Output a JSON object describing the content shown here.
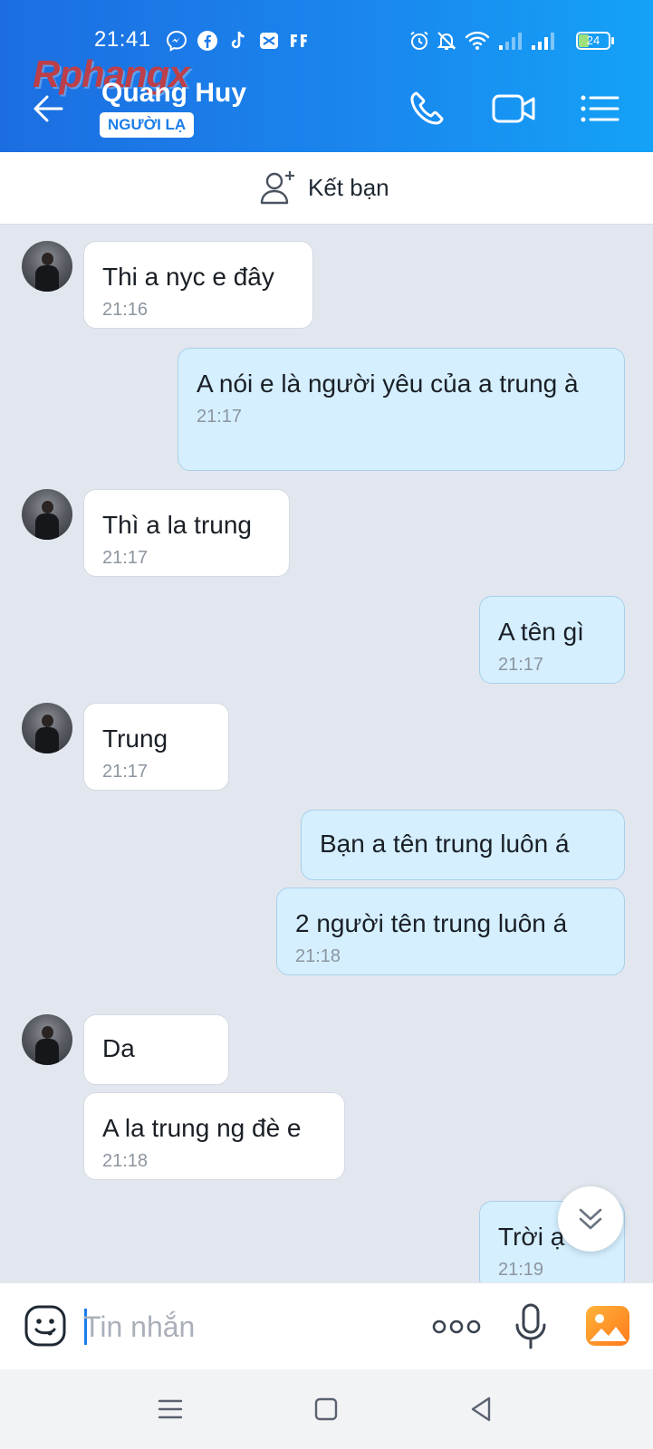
{
  "status_bar": {
    "time": "21:41",
    "battery": "24"
  },
  "watermark": "Rphangx",
  "header": {
    "title": "Quang Huy",
    "badge": "NGƯỜI LẠ"
  },
  "add_friend": {
    "label": "Kết bạn"
  },
  "messages": [
    {
      "side": "in",
      "text": "Thi a nyc e đây",
      "time": "21:16"
    },
    {
      "side": "out",
      "text": "A nói e là người yêu của a trung à",
      "time": "21:17"
    },
    {
      "side": "in",
      "text": "Thì a la trung",
      "time": "21:17"
    },
    {
      "side": "out",
      "text": "A tên gì",
      "time": "21:17"
    },
    {
      "side": "in",
      "text": "Trung",
      "time": "21:17"
    },
    {
      "side": "out",
      "text": "Bạn a tên trung luôn á",
      "time": ""
    },
    {
      "side": "out",
      "text": "2 người tên trung luôn á",
      "time": "21:18"
    },
    {
      "side": "in",
      "text": "Da",
      "time": ""
    },
    {
      "side": "in",
      "text": "A la trung ng đè e",
      "time": "21:18"
    },
    {
      "side": "out",
      "text": "Trời ạ",
      "time": "21:19"
    }
  ],
  "composer": {
    "placeholder": "Tin nhắn"
  },
  "colors": {
    "header_start": "#1c6ee0",
    "header_end": "#14a2f7",
    "outgoing_bubble": "#d5efff",
    "incoming_bubble": "#ffffff",
    "chat_background": "#e2e7ef",
    "accent": "#1b7de8"
  },
  "icons": {
    "back": "arrow-left-icon",
    "call": "phone-icon",
    "video": "video-camera-icon",
    "menu": "list-menu-icon",
    "add_friend": "add-user-icon",
    "emoji": "emoji-icon",
    "more": "more-dots-icon",
    "mic": "microphone-icon",
    "gallery": "image-gallery-icon",
    "scroll": "double-chevron-down-icon"
  }
}
